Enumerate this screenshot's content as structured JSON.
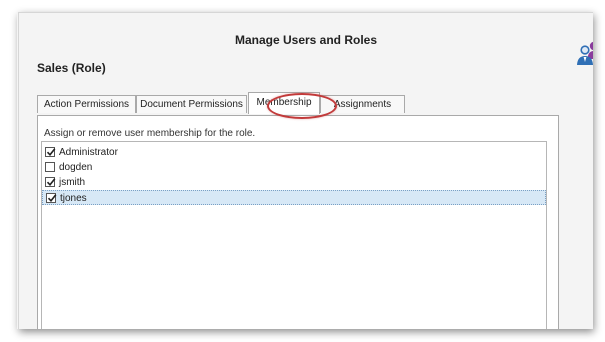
{
  "dialog": {
    "title": "Manage Users and Roles",
    "role_heading": "Sales (Role)"
  },
  "tabs": [
    {
      "label": "Action Permissions",
      "active": false
    },
    {
      "label": "Document Permissions",
      "active": false
    },
    {
      "label": "Membership",
      "active": true
    },
    {
      "label": "Assignments",
      "active": false
    }
  ],
  "membership": {
    "hint": "Assign or remove user membership for the role.",
    "users": [
      {
        "name": "Administrator",
        "checked": true,
        "selected": false
      },
      {
        "name": "dogden",
        "checked": false,
        "selected": false
      },
      {
        "name": "jsmith",
        "checked": true,
        "selected": false
      },
      {
        "name": "tjones",
        "checked": true,
        "selected": true
      }
    ]
  },
  "icons": {
    "app": "users-roles-icon",
    "check": "checkmark-icon"
  },
  "colors": {
    "highlight_ring": "#c23a3a",
    "selected_row": "#d7e8f6",
    "icon_blue": "#2f6fb5",
    "icon_purple": "#8a3c9c"
  }
}
